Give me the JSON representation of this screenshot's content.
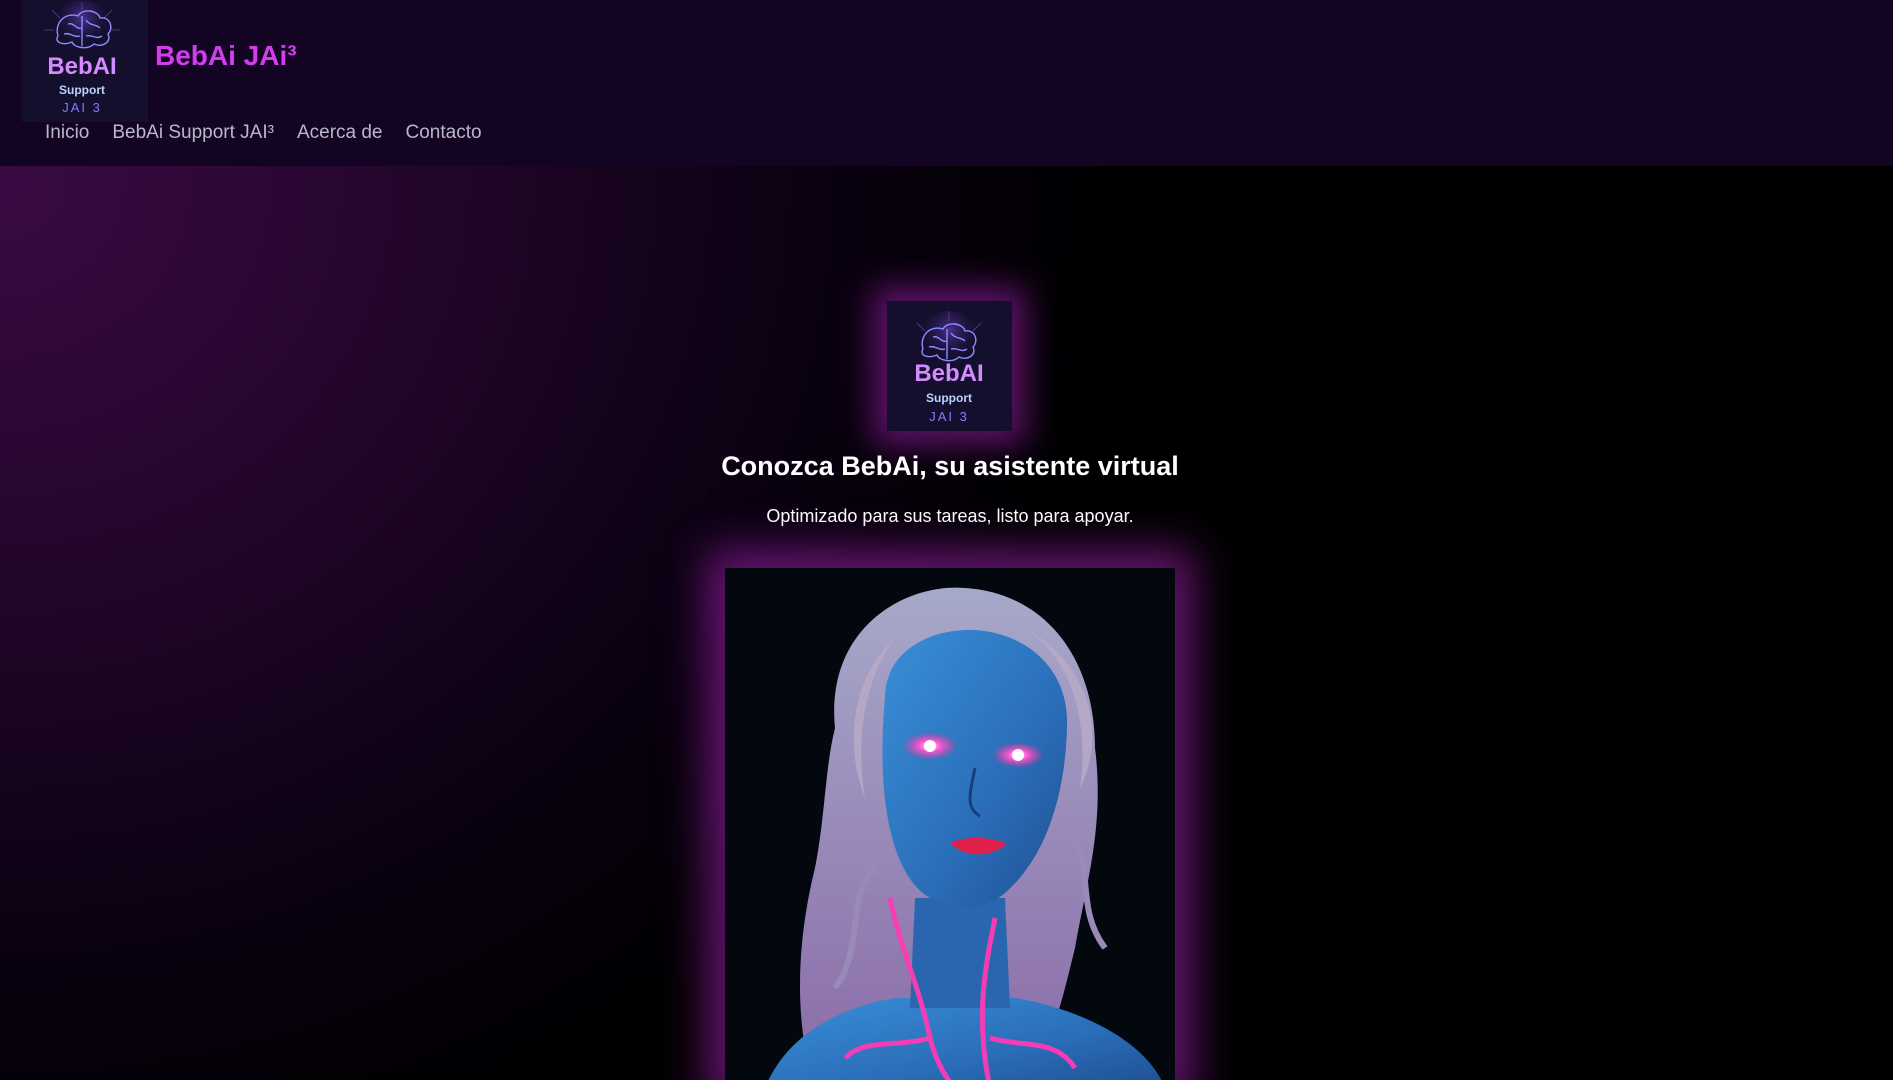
{
  "header": {
    "brand_title": "BebAi JAi³",
    "logo": {
      "name": "BebAI",
      "tagline": "Support",
      "sub": "JAI 3"
    },
    "nav": [
      {
        "label": "Inicio"
      },
      {
        "label": "BebAi Support JAI³"
      },
      {
        "label": "Acerca de"
      },
      {
        "label": "Contacto"
      }
    ]
  },
  "hero": {
    "logo": {
      "name": "BebAI",
      "tagline": "Support",
      "sub": "JAI 3"
    },
    "title": "Conozca BebAi, su asistente virtual",
    "subtitle": "Optimizado para sus tareas, listo para apoyar."
  },
  "colors": {
    "header_bg": "#140424",
    "brand_accent": "#d43cf0",
    "glow": "#c828dc",
    "nav_text": "#b8b8c8"
  },
  "icons": [
    "brain-icon"
  ]
}
